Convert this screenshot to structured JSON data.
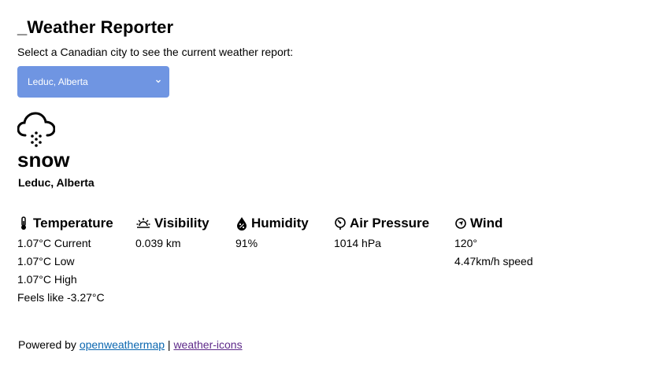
{
  "app": {
    "title": "_Weather Reporter",
    "prompt": "Select a Canadian city to see the current weather report:"
  },
  "city_select": {
    "selected": "Leduc, Alberta",
    "color": "#6f95e2"
  },
  "weather": {
    "icon": "snow-cloud-icon",
    "condition": "snow",
    "location": "Leduc, Alberta"
  },
  "metrics": {
    "temperature": {
      "label": "Temperature",
      "icon": "thermometer-icon",
      "current": "1.07°C Current",
      "low": "1.07°C Low",
      "high": "1.07°C High",
      "feels_like": "Feels like -3.27°C"
    },
    "visibility": {
      "label": "Visibility",
      "icon": "sunrise-icon",
      "value": "0.039 km"
    },
    "humidity": {
      "label": "Humidity",
      "icon": "humidity-drop-icon",
      "value": "91%"
    },
    "air_pressure": {
      "label": "Air Pressure",
      "icon": "barometer-icon",
      "value": "1014 hPa"
    },
    "wind": {
      "label": "Wind",
      "icon": "wind-direction-icon",
      "direction": "120°",
      "speed": "4.47km/h speed"
    }
  },
  "footer": {
    "prefix": "Powered by ",
    "link1": "openweathermap",
    "separator": " | ",
    "link2": "weather-icons"
  }
}
